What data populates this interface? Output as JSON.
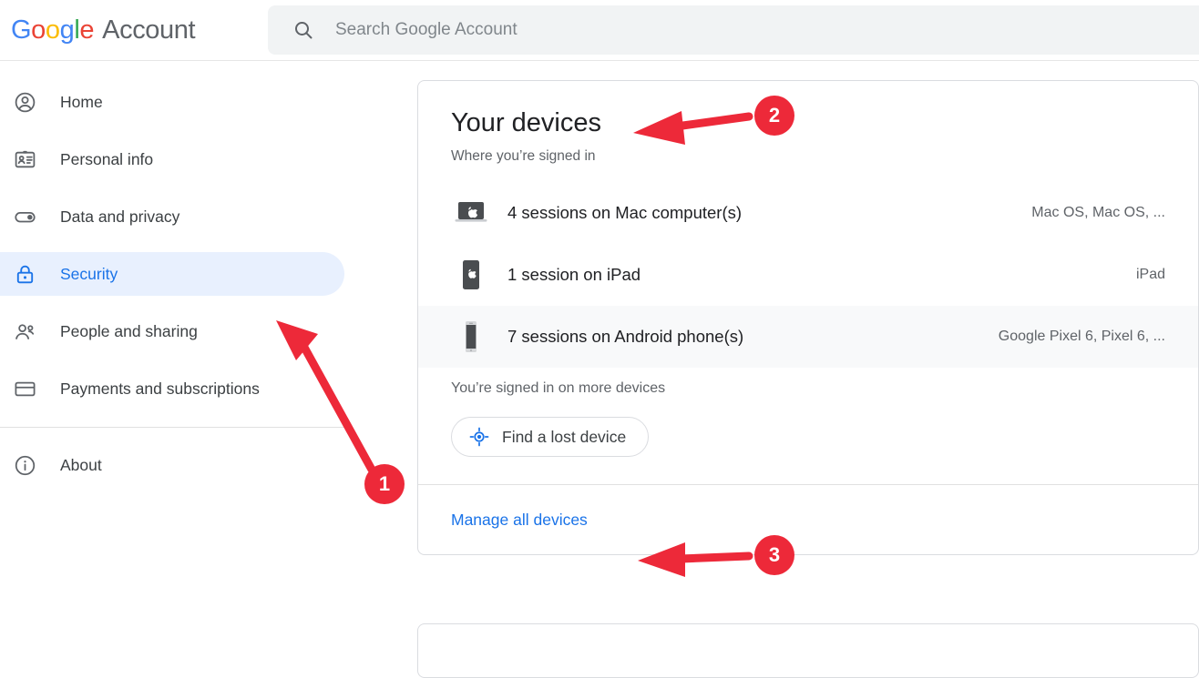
{
  "header": {
    "brand": {
      "g_letters": [
        "G",
        "o",
        "o",
        "g",
        "l",
        "e"
      ],
      "account_word": "Account"
    },
    "search": {
      "icon": "search-icon",
      "placeholder": "Search Google Account",
      "value": ""
    }
  },
  "sidebar": {
    "items": [
      {
        "label": "Home",
        "icon": "account-circle-icon",
        "active": false
      },
      {
        "label": "Personal info",
        "icon": "badge-id-icon",
        "active": false
      },
      {
        "label": "Data and privacy",
        "icon": "toggle-switch-icon",
        "active": false
      },
      {
        "label": "Security",
        "icon": "lock-icon",
        "active": true
      },
      {
        "label": "People and sharing",
        "icon": "people-icon",
        "active": false
      },
      {
        "label": "Payments and subscriptions",
        "icon": "credit-card-icon",
        "active": false
      },
      {
        "label": "About",
        "icon": "info-circle-icon",
        "active": false
      }
    ]
  },
  "main": {
    "card": {
      "title": "Your devices",
      "subtitle": "Where you’re signed in",
      "devices": [
        {
          "name": "4 sessions on Mac computer(s)",
          "meta": "Mac OS, Mac OS, ...",
          "icon": "laptop-icon",
          "hovered": false
        },
        {
          "name": "1 session on iPad",
          "meta": "iPad",
          "icon": "tablet-icon",
          "hovered": false
        },
        {
          "name": "7 sessions on Android phone(s)",
          "meta": "Google Pixel 6, Pixel 6, ...",
          "icon": "phone-icon",
          "hovered": true
        }
      ],
      "more_devices_text": "You’re signed in on more devices",
      "find_button": {
        "label": "Find a lost device",
        "icon": "my-location-icon"
      },
      "footer_link": "Manage all devices"
    }
  },
  "annotations": {
    "color": "#ED2939",
    "markers": [
      {
        "number": "1",
        "target": "sidebar-item-security"
      },
      {
        "number": "2",
        "target": "your-devices-title"
      },
      {
        "number": "3",
        "target": "manage-all-devices-link"
      }
    ]
  },
  "colors": {
    "google_blue": "#1a73e8",
    "active_pill": "#e8f0fe",
    "annotation_red": "#ED2939",
    "text_primary": "#202124",
    "text_secondary": "#5f6368"
  }
}
